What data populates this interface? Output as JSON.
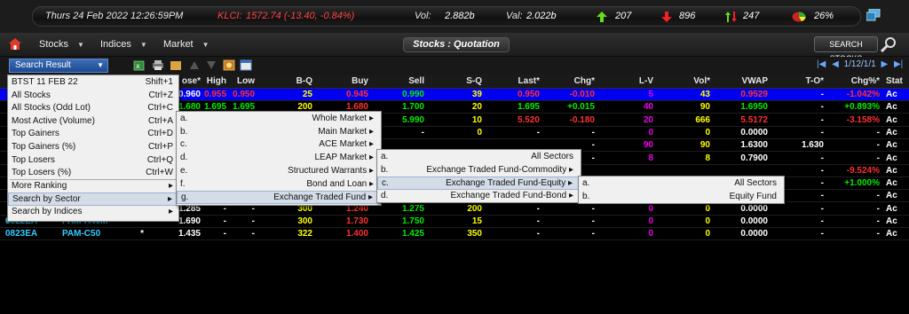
{
  "ticker": {
    "datetime": "Thurs 24 Feb 2022  12:26:59PM",
    "klci_label": "KLCI:",
    "klci_value": "1572.74 (-13.40, -0.84%)",
    "vol_label": "Vol:",
    "vol_value": "2.882b",
    "val_label": "Val:",
    "val_value": "2.022b",
    "up_count": "207",
    "down_count": "896",
    "unchanged_count": "247",
    "pct": "26%"
  },
  "menubar": {
    "stocks": "Stocks",
    "indices": "Indices",
    "market": "Market",
    "view_title": "Stocks : Quotation",
    "search_button": "SEARCH STOCKS"
  },
  "toolbar": {
    "selected": "Search Result",
    "pager": "1/12/1/1"
  },
  "table": {
    "headers": [
      "ose*",
      "High",
      "Low",
      "B-Q",
      "Buy",
      "Sell",
      "S-Q",
      "Last*",
      "Chg*",
      "L-V",
      "Vol*",
      "VWAP",
      "T-O*",
      "Chg%*",
      "Stat"
    ],
    "rows": [
      {
        "code": "",
        "name": "",
        "flag": "",
        "close": "0.960",
        "high": "0.955",
        "low": "0.950",
        "bq": "25",
        "buy": "0.945",
        "sell": "0.990",
        "sq": "39",
        "last": "0.950",
        "chg": "-0.010",
        "lv": "5",
        "vol": "43",
        "vwap": "0.9529",
        "to": "-",
        "chgpct": "-1.042%",
        "stat": "Ac"
      },
      {
        "code": "",
        "name": "",
        "flag": "",
        "close": "1.680",
        "high": "1.695",
        "low": "1.695",
        "bq": "200",
        "buy": "1.680",
        "sell": "1.700",
        "sq": "20",
        "last": "1.695",
        "chg": "+0.015",
        "lv": "40",
        "vol": "90",
        "vwap": "1.6950",
        "to": "-",
        "chgpct": "+0.893%",
        "stat": "Ac"
      },
      {
        "code": "",
        "name": "",
        "flag": "",
        "close": "",
        "high": "",
        "low": "",
        "bq": "",
        "buy": "",
        "sell": "5.990",
        "sq": "10",
        "last": "5.520",
        "chg": "-0.180",
        "lv": "20",
        "vol": "666",
        "vwap": "5.5172",
        "to": "-",
        "chgpct": "-3.158%",
        "stat": "Ac"
      },
      {
        "code": "",
        "name": "",
        "flag": "",
        "close": "",
        "high": "",
        "low": "",
        "bq": "",
        "buy": "",
        "sell": "-",
        "sq": "0",
        "last": "-",
        "chg": "-",
        "lv": "0",
        "vol": "0",
        "vwap": "0.0000",
        "to": "-",
        "chgpct": "-",
        "stat": "Ac"
      },
      {
        "code": "",
        "name": "",
        "flag": "",
        "close": "",
        "high": "",
        "low": "",
        "bq": "",
        "buy": "",
        "sell": "",
        "sq": "",
        "last": "",
        "chg": "-",
        "lv": "90",
        "vol": "90",
        "vwap": "1.6300",
        "to": "1.630",
        "chgpct": "-",
        "stat": "Ac"
      },
      {
        "code": "",
        "name": "",
        "flag": "",
        "close": "",
        "high": "",
        "low": "",
        "bq": "",
        "buy": "",
        "sell": "",
        "sq": "",
        "last": "",
        "chg": "-",
        "lv": "8",
        "vol": "8",
        "vwap": "0.7900",
        "to": "-",
        "chgpct": "-",
        "stat": "Ac"
      },
      {
        "code": "",
        "name": "",
        "flag": "",
        "close": "",
        "high": "",
        "low": "",
        "bq": "",
        "buy": "",
        "sell": "",
        "sq": "",
        "last": "",
        "chg": "",
        "lv": "",
        "vol": "",
        "vwap": "",
        "to": "-",
        "chgpct": "-9.524%",
        "stat": "Ac"
      },
      {
        "code": "",
        "name": "",
        "flag": "",
        "close": "",
        "high": "",
        "low": "",
        "bq": "",
        "buy": "",
        "sell": "",
        "sq": "",
        "last": "",
        "chg": "",
        "lv": "",
        "vol": "",
        "vwap": "",
        "to": "-",
        "chgpct": "+1.000%",
        "stat": "Ac"
      },
      {
        "code": "",
        "name": "",
        "flag": "",
        "close": "",
        "high": "",
        "low": "",
        "bq": "",
        "buy": "",
        "sell": "",
        "sq": "",
        "last": "",
        "chg": "",
        "lv": "",
        "vol": "",
        "vwap": "",
        "to": "-",
        "chgpct": "-",
        "stat": "Ac"
      },
      {
        "code": "",
        "name": "",
        "flag": "",
        "close": "1.285",
        "high": "-",
        "low": "-",
        "bq": "300",
        "buy": "1.240",
        "sell": "1.275",
        "sq": "200",
        "last": "-",
        "chg": "-",
        "lv": "0",
        "vol": "0",
        "vwap": "0.0000",
        "to": "-",
        "chgpct": "-",
        "stat": "Ac"
      },
      {
        "code": "0822EA",
        "name": "PAM-A40M",
        "flag": "*",
        "close": "1.690",
        "high": "-",
        "low": "-",
        "bq": "300",
        "buy": "1.730",
        "sell": "1.750",
        "sq": "15",
        "last": "-",
        "chg": "-",
        "lv": "0",
        "vol": "0",
        "vwap": "0.0000",
        "to": "-",
        "chgpct": "-",
        "stat": "Ac"
      },
      {
        "code": "0823EA",
        "name": "PAM-C50",
        "flag": "*",
        "close": "1.435",
        "high": "-",
        "low": "-",
        "bq": "322",
        "buy": "1.400",
        "sell": "1.425",
        "sq": "350",
        "last": "-",
        "chg": "-",
        "lv": "0",
        "vol": "0",
        "vwap": "0.0000",
        "to": "-",
        "chgpct": "-",
        "stat": "Ac"
      }
    ]
  },
  "menu1": [
    {
      "label": "BTST 11 FEB 22",
      "shortcut": "Shift+1"
    },
    {
      "label": "All Stocks",
      "shortcut": "Ctrl+Z"
    },
    {
      "label": "All Stocks (Odd Lot)",
      "shortcut": "Ctrl+C"
    },
    {
      "label": "Most Active (Volume)",
      "shortcut": "Ctrl+A"
    },
    {
      "label": "Top Gainers",
      "shortcut": "Ctrl+D"
    },
    {
      "label": "Top Gainers (%)",
      "shortcut": "Ctrl+P"
    },
    {
      "label": "Top Losers",
      "shortcut": "Ctrl+Q"
    },
    {
      "label": "Top Losers (%)",
      "shortcut": "Ctrl+W"
    },
    {
      "label": "More Ranking",
      "shortcut": "▸"
    },
    {
      "label": "Search by Sector",
      "shortcut": "▸"
    },
    {
      "label": "Search by Indices",
      "shortcut": "▸"
    }
  ],
  "menu2": [
    {
      "key": "a.",
      "label": "Whole Market ▸"
    },
    {
      "key": "b.",
      "label": "Main Market ▸"
    },
    {
      "key": "c.",
      "label": "ACE Market ▸"
    },
    {
      "key": "d.",
      "label": "LEAP Market ▸"
    },
    {
      "key": "e.",
      "label": "Structured Warrants ▸"
    },
    {
      "key": "f.",
      "label": "Bond and Loan ▸"
    },
    {
      "key": "g.",
      "label": "Exchange Traded Fund ▸"
    }
  ],
  "menu3": [
    {
      "key": "a.",
      "label": "All Sectors"
    },
    {
      "key": "b.",
      "label": "Exchange Traded Fund-Commodity ▸"
    },
    {
      "key": "c.",
      "label": "Exchange Traded Fund-Equity ▸"
    },
    {
      "key": "d.",
      "label": "Exchange Traded Fund-Bond ▸"
    }
  ],
  "menu4": [
    {
      "key": "a.",
      "label": "All Sectors"
    },
    {
      "key": "b.",
      "label": "Equity Fund"
    }
  ],
  "colors": {
    "selected_row": "#0000ee",
    "gain": "#00ee00",
    "loss": "#ff3030",
    "neutral": "#ffff00",
    "quantity": "#ffff00",
    "buy": "#ff3030",
    "sell": "#00ee00",
    "vol": "#ffff00",
    "lv": "#ee00ee",
    "code": "#33ccff"
  }
}
